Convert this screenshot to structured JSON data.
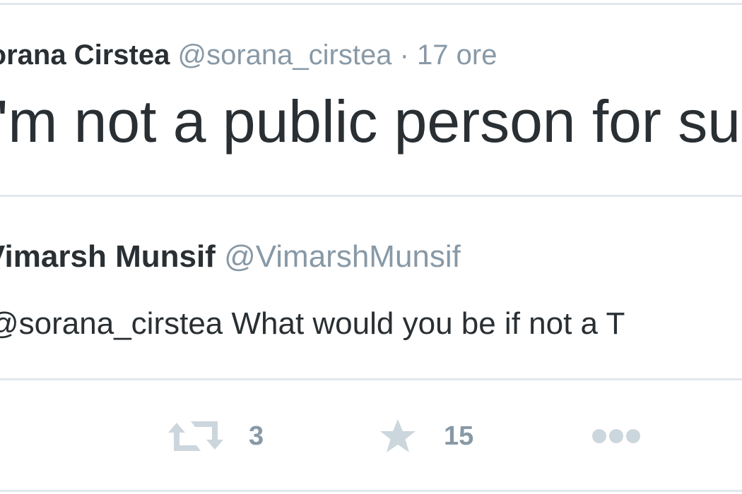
{
  "tweet": {
    "author_name": "Sorana Cirstea",
    "author_handle": "@sorana_cirstea",
    "separator": "·",
    "time": "17 ore",
    "text": "I'm not a public person for su"
  },
  "quoted": {
    "author_name": "Vimarsh Munsif",
    "author_handle": "@VimarshMunsif",
    "text": "@sorana_cirstea What would you be if not a T"
  },
  "actions": {
    "retweet_count": "3",
    "favorite_count": "15"
  },
  "icons": {
    "retweet": "retweet-icon",
    "favorite": "star-icon",
    "more": "more-dots-icon"
  },
  "colors": {
    "text": "#292f33",
    "muted": "#8899a6",
    "icon": "#ccd6dd",
    "divider": "#e1e8ed"
  }
}
